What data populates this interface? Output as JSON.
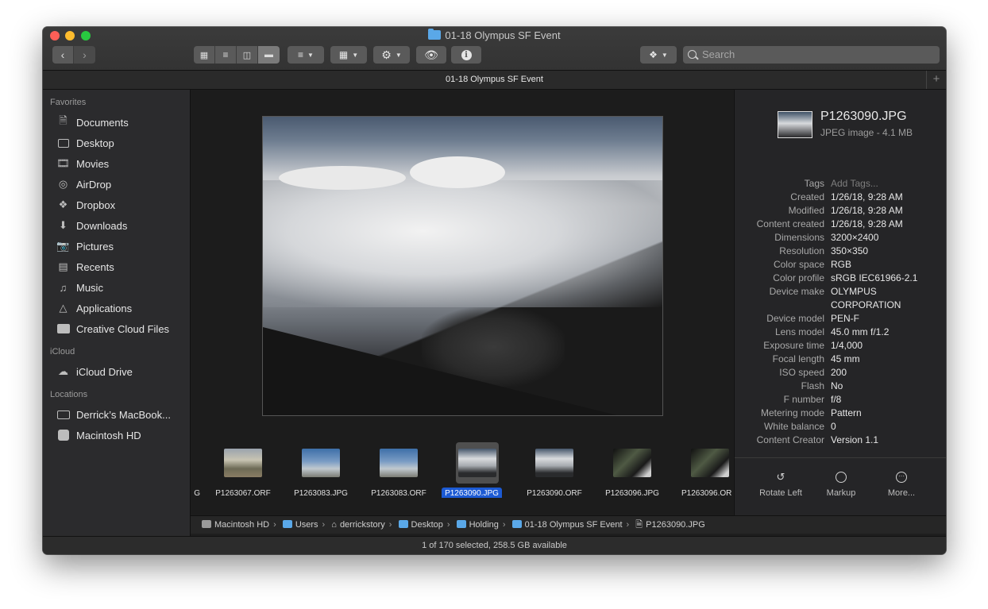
{
  "window": {
    "title": "01-18 Olympus SF Event"
  },
  "tab": {
    "label": "01-18 Olympus SF Event"
  },
  "toolbar": {
    "search_placeholder": "Search",
    "view_icons": [
      "icon-view-icon",
      "list-view-icon",
      "column-view-icon",
      "gallery-view-icon"
    ],
    "active_view": "gallery"
  },
  "sidebar": {
    "favorites_heading": "Favorites",
    "favorites": [
      {
        "label": "Documents",
        "icon": "documents-icon"
      },
      {
        "label": "Desktop",
        "icon": "desktop-icon"
      },
      {
        "label": "Movies",
        "icon": "movies-icon"
      },
      {
        "label": "AirDrop",
        "icon": "airdrop-icon"
      },
      {
        "label": "Dropbox",
        "icon": "dropbox-icon"
      },
      {
        "label": "Downloads",
        "icon": "downloads-icon"
      },
      {
        "label": "Pictures",
        "icon": "pictures-icon"
      },
      {
        "label": "Recents",
        "icon": "recents-icon"
      },
      {
        "label": "Music",
        "icon": "music-icon"
      },
      {
        "label": "Applications",
        "icon": "applications-icon"
      },
      {
        "label": "Creative Cloud Files",
        "icon": "folder-icon"
      }
    ],
    "icloud_heading": "iCloud",
    "icloud": [
      {
        "label": "iCloud Drive",
        "icon": "cloud-icon"
      }
    ],
    "locations_heading": "Locations",
    "locations": [
      {
        "label": "Derrick’s MacBook...",
        "icon": "laptop-icon"
      },
      {
        "label": "Macintosh HD",
        "icon": "hard-drive-icon"
      }
    ]
  },
  "gallery": {
    "thumbnails": [
      {
        "label": "G",
        "kind": "dark"
      },
      {
        "label": "P1263067.ORF",
        "kind": "hike"
      },
      {
        "label": "P1263083.JPG",
        "kind": "sky"
      },
      {
        "label": "P1263083.ORF",
        "kind": "sky"
      },
      {
        "label": "P1263090.JPG",
        "kind": "fog",
        "selected": true
      },
      {
        "label": "P1263090.ORF",
        "kind": "fog"
      },
      {
        "label": "P1263096.JPG",
        "kind": "dark"
      },
      {
        "label": "P1263096.OR",
        "kind": "dark"
      }
    ]
  },
  "inspector": {
    "file_name": "P1263090.JPG",
    "file_kind": "JPEG image - 4.1 MB",
    "metadata": [
      {
        "key": "Tags",
        "value": "Add Tags...",
        "placeholder": true
      },
      {
        "key": "Created",
        "value": "1/26/18, 9:28 AM"
      },
      {
        "key": "Modified",
        "value": "1/26/18, 9:28 AM"
      },
      {
        "key": "Content created",
        "value": "1/26/18, 9:28 AM"
      },
      {
        "key": "Dimensions",
        "value": "3200×2400"
      },
      {
        "key": "Resolution",
        "value": "350×350"
      },
      {
        "key": "Color space",
        "value": "RGB"
      },
      {
        "key": "Color profile",
        "value": "sRGB IEC61966-2.1"
      },
      {
        "key": "Device make",
        "value": "OLYMPUS CORPORATION"
      },
      {
        "key": "Device model",
        "value": "PEN-F"
      },
      {
        "key": "Lens model",
        "value": "45.0 mm f/1.2"
      },
      {
        "key": "Exposure time",
        "value": "1/4,000"
      },
      {
        "key": "Focal length",
        "value": "45 mm"
      },
      {
        "key": "ISO speed",
        "value": "200"
      },
      {
        "key": "Flash",
        "value": "No"
      },
      {
        "key": "F number",
        "value": "f/8"
      },
      {
        "key": "Metering mode",
        "value": "Pattern"
      },
      {
        "key": "White balance",
        "value": "0"
      },
      {
        "key": "Content Creator",
        "value": "Version 1.1"
      }
    ],
    "actions": [
      {
        "label": "Rotate Left",
        "icon": "rotate-left-icon"
      },
      {
        "label": "Markup",
        "icon": "markup-icon"
      },
      {
        "label": "More...",
        "icon": "more-icon"
      }
    ]
  },
  "pathbar": [
    {
      "label": "Macintosh HD",
      "icon": "hard-drive-icon"
    },
    {
      "label": "Users",
      "icon": "folder-icon"
    },
    {
      "label": "derrickstory",
      "icon": "home-icon"
    },
    {
      "label": "Desktop",
      "icon": "folder-icon"
    },
    {
      "label": "Holding",
      "icon": "folder-icon"
    },
    {
      "label": "01-18 Olympus SF Event",
      "icon": "folder-icon"
    },
    {
      "label": "P1263090.JPG",
      "icon": "file-icon"
    }
  ],
  "status": {
    "text": "1 of 170 selected, 258.5 GB available"
  },
  "colors": {
    "selection": "#1c5ad4",
    "folder": "#5aa8e8"
  }
}
